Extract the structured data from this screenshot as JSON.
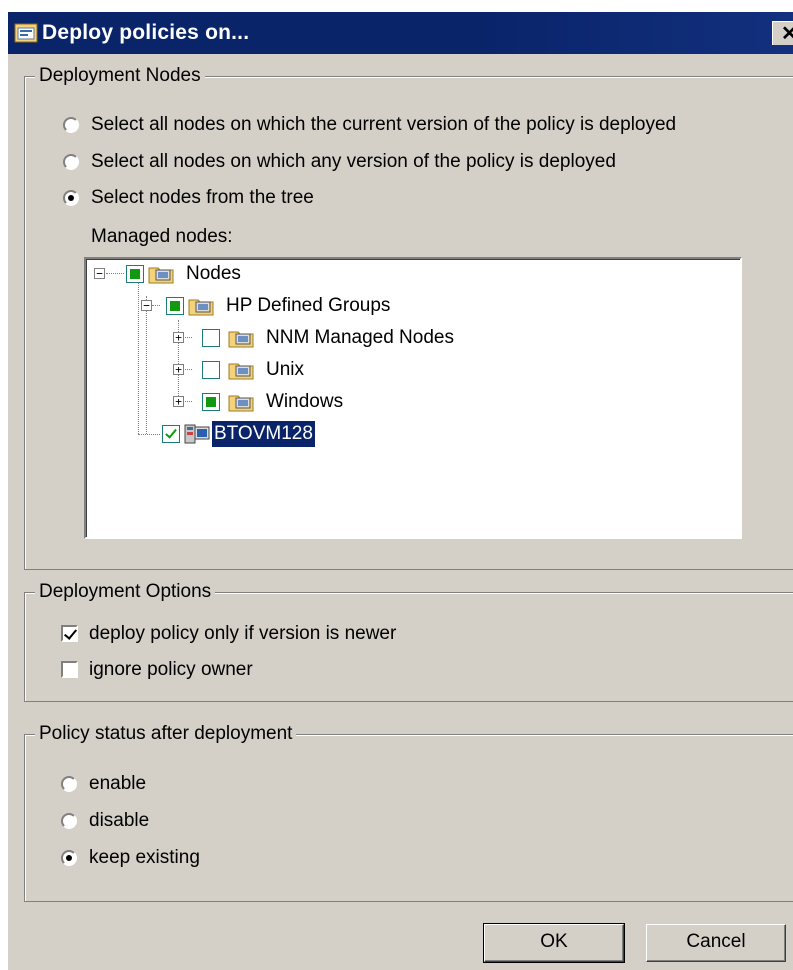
{
  "window": {
    "title": "Deploy policies on...",
    "close_glyph": "✕"
  },
  "deployment_nodes": {
    "label": "Deployment Nodes",
    "options": [
      {
        "label": "Select all nodes on which the current version of the policy is deployed",
        "checked": false
      },
      {
        "label": "Select all nodes on which any version of the policy is deployed",
        "checked": false
      },
      {
        "label": "Select nodes from the tree",
        "checked": true
      }
    ],
    "managed_nodes_label": "Managed nodes:",
    "tree": [
      {
        "label": "Nodes",
        "state": "partial",
        "expander": "−"
      },
      {
        "label": "HP Defined Groups",
        "state": "partial",
        "expander": "−"
      },
      {
        "label": "NNM Managed Nodes",
        "state": "unchecked",
        "expander": "+"
      },
      {
        "label": "Unix",
        "state": "unchecked",
        "expander": "+"
      },
      {
        "label": "Windows",
        "state": "partial",
        "expander": "+"
      },
      {
        "label": "BTOVM128",
        "state": "checked",
        "selected": true
      }
    ]
  },
  "deployment_options": {
    "label": "Deployment Options",
    "options": [
      {
        "label": "deploy policy only if version is newer",
        "checked": true
      },
      {
        "label": "ignore policy owner",
        "checked": false
      }
    ]
  },
  "policy_status": {
    "label": "Policy status after deployment",
    "options": [
      {
        "label": "enable",
        "checked": false
      },
      {
        "label": "disable",
        "checked": false
      },
      {
        "label": "keep existing",
        "checked": true
      }
    ]
  },
  "buttons": {
    "ok": "OK",
    "cancel": "Cancel"
  },
  "colors": {
    "titlebar": "#0a246a",
    "dialog_bg": "#d4d0c8",
    "tree_check_fill": "#119911",
    "selection": "#0a246a"
  }
}
